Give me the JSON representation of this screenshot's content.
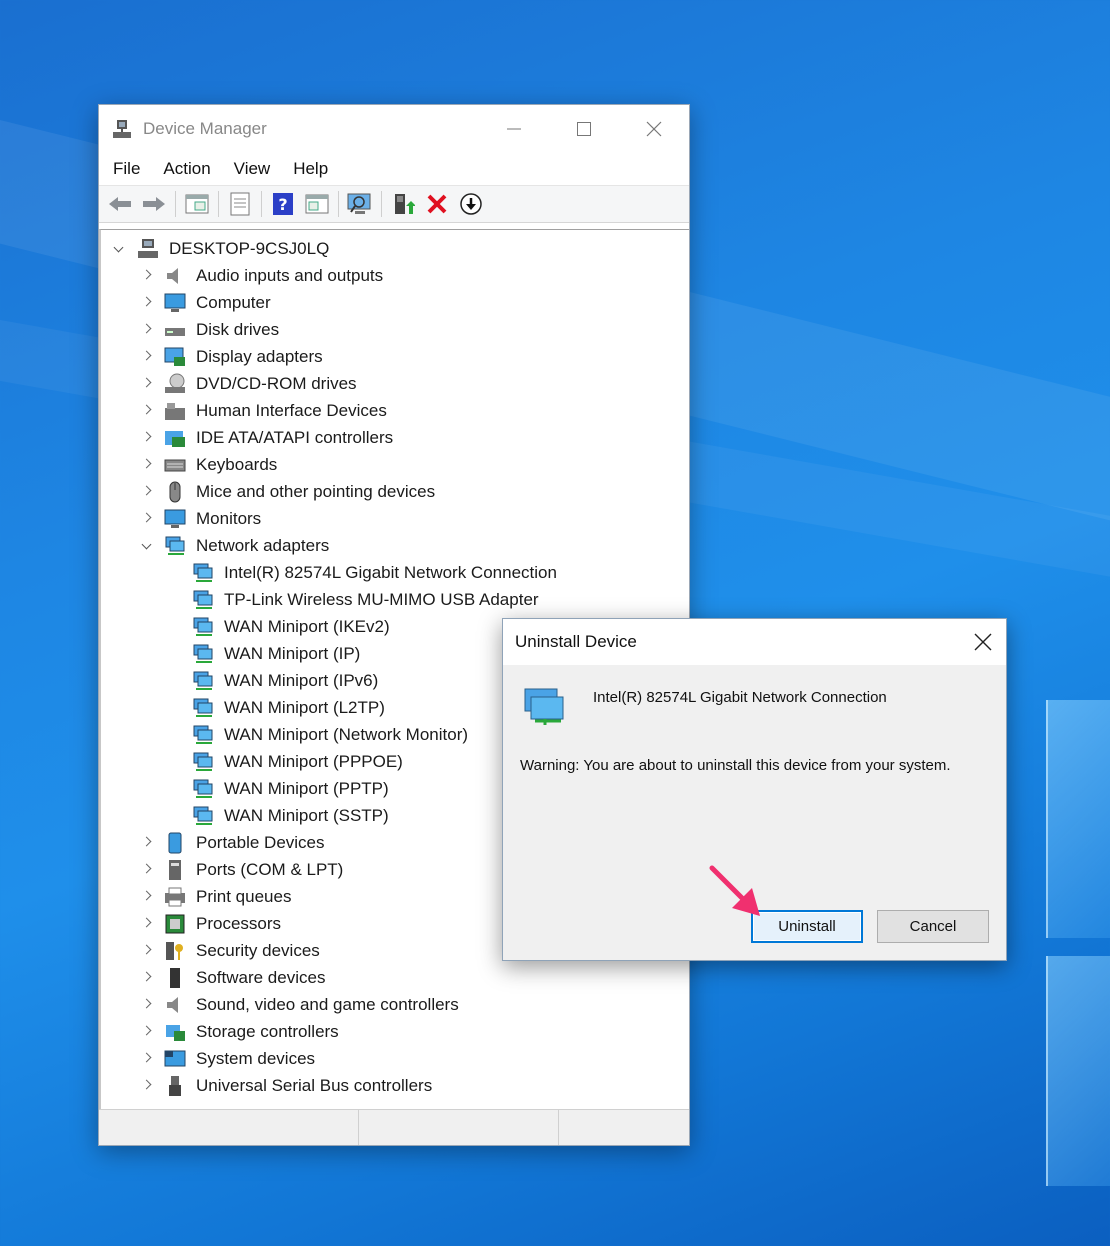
{
  "window": {
    "title": "Device Manager",
    "menu": [
      "File",
      "Action",
      "View",
      "Help"
    ]
  },
  "tree": {
    "root": "DESKTOP-9CSJ0LQ",
    "categories": [
      {
        "label": "Audio inputs and outputs",
        "icon": "speaker-icon"
      },
      {
        "label": "Computer",
        "icon": "computer-icon"
      },
      {
        "label": "Disk drives",
        "icon": "disk-drive-icon"
      },
      {
        "label": "Display adapters",
        "icon": "display-adapter-icon"
      },
      {
        "label": "DVD/CD-ROM drives",
        "icon": "dvd-drive-icon"
      },
      {
        "label": "Human Interface Devices",
        "icon": "hid-icon"
      },
      {
        "label": "IDE ATA/ATAPI controllers",
        "icon": "ide-controller-icon"
      },
      {
        "label": "Keyboards",
        "icon": "keyboard-icon"
      },
      {
        "label": "Mice and other pointing devices",
        "icon": "mouse-icon"
      },
      {
        "label": "Monitors",
        "icon": "monitor-icon"
      },
      {
        "label": "Network adapters",
        "icon": "network-adapter-icon",
        "expanded": true
      }
    ],
    "network_children": [
      "Intel(R) 82574L Gigabit Network Connection",
      "TP-Link Wireless MU-MIMO USB Adapter",
      "WAN Miniport (IKEv2)",
      "WAN Miniport (IP)",
      "WAN Miniport (IPv6)",
      "WAN Miniport (L2TP)",
      "WAN Miniport (Network Monitor)",
      "WAN Miniport (PPPOE)",
      "WAN Miniport (PPTP)",
      "WAN Miniport (SSTP)"
    ],
    "categories_after": [
      {
        "label": "Portable Devices",
        "icon": "portable-device-icon"
      },
      {
        "label": "Ports (COM & LPT)",
        "icon": "port-icon"
      },
      {
        "label": "Print queues",
        "icon": "printer-icon"
      },
      {
        "label": "Processors",
        "icon": "processor-icon"
      },
      {
        "label": "Security devices",
        "icon": "security-device-icon"
      },
      {
        "label": "Software devices",
        "icon": "software-device-icon"
      },
      {
        "label": "Sound, video and game controllers",
        "icon": "speaker-icon"
      },
      {
        "label": "Storage controllers",
        "icon": "storage-controller-icon"
      },
      {
        "label": "System devices",
        "icon": "system-device-icon"
      },
      {
        "label": "Universal Serial Bus controllers",
        "icon": "usb-icon"
      }
    ]
  },
  "dialog": {
    "title": "Uninstall Device",
    "device_name": "Intel(R) 82574L Gigabit Network Connection",
    "warning": "Warning: You are about to uninstall this device from your system.",
    "uninstall_label": "Uninstall",
    "cancel_label": "Cancel"
  },
  "colors": {
    "accent": "#0078d7",
    "annotation_arrow": "#f0306f"
  }
}
